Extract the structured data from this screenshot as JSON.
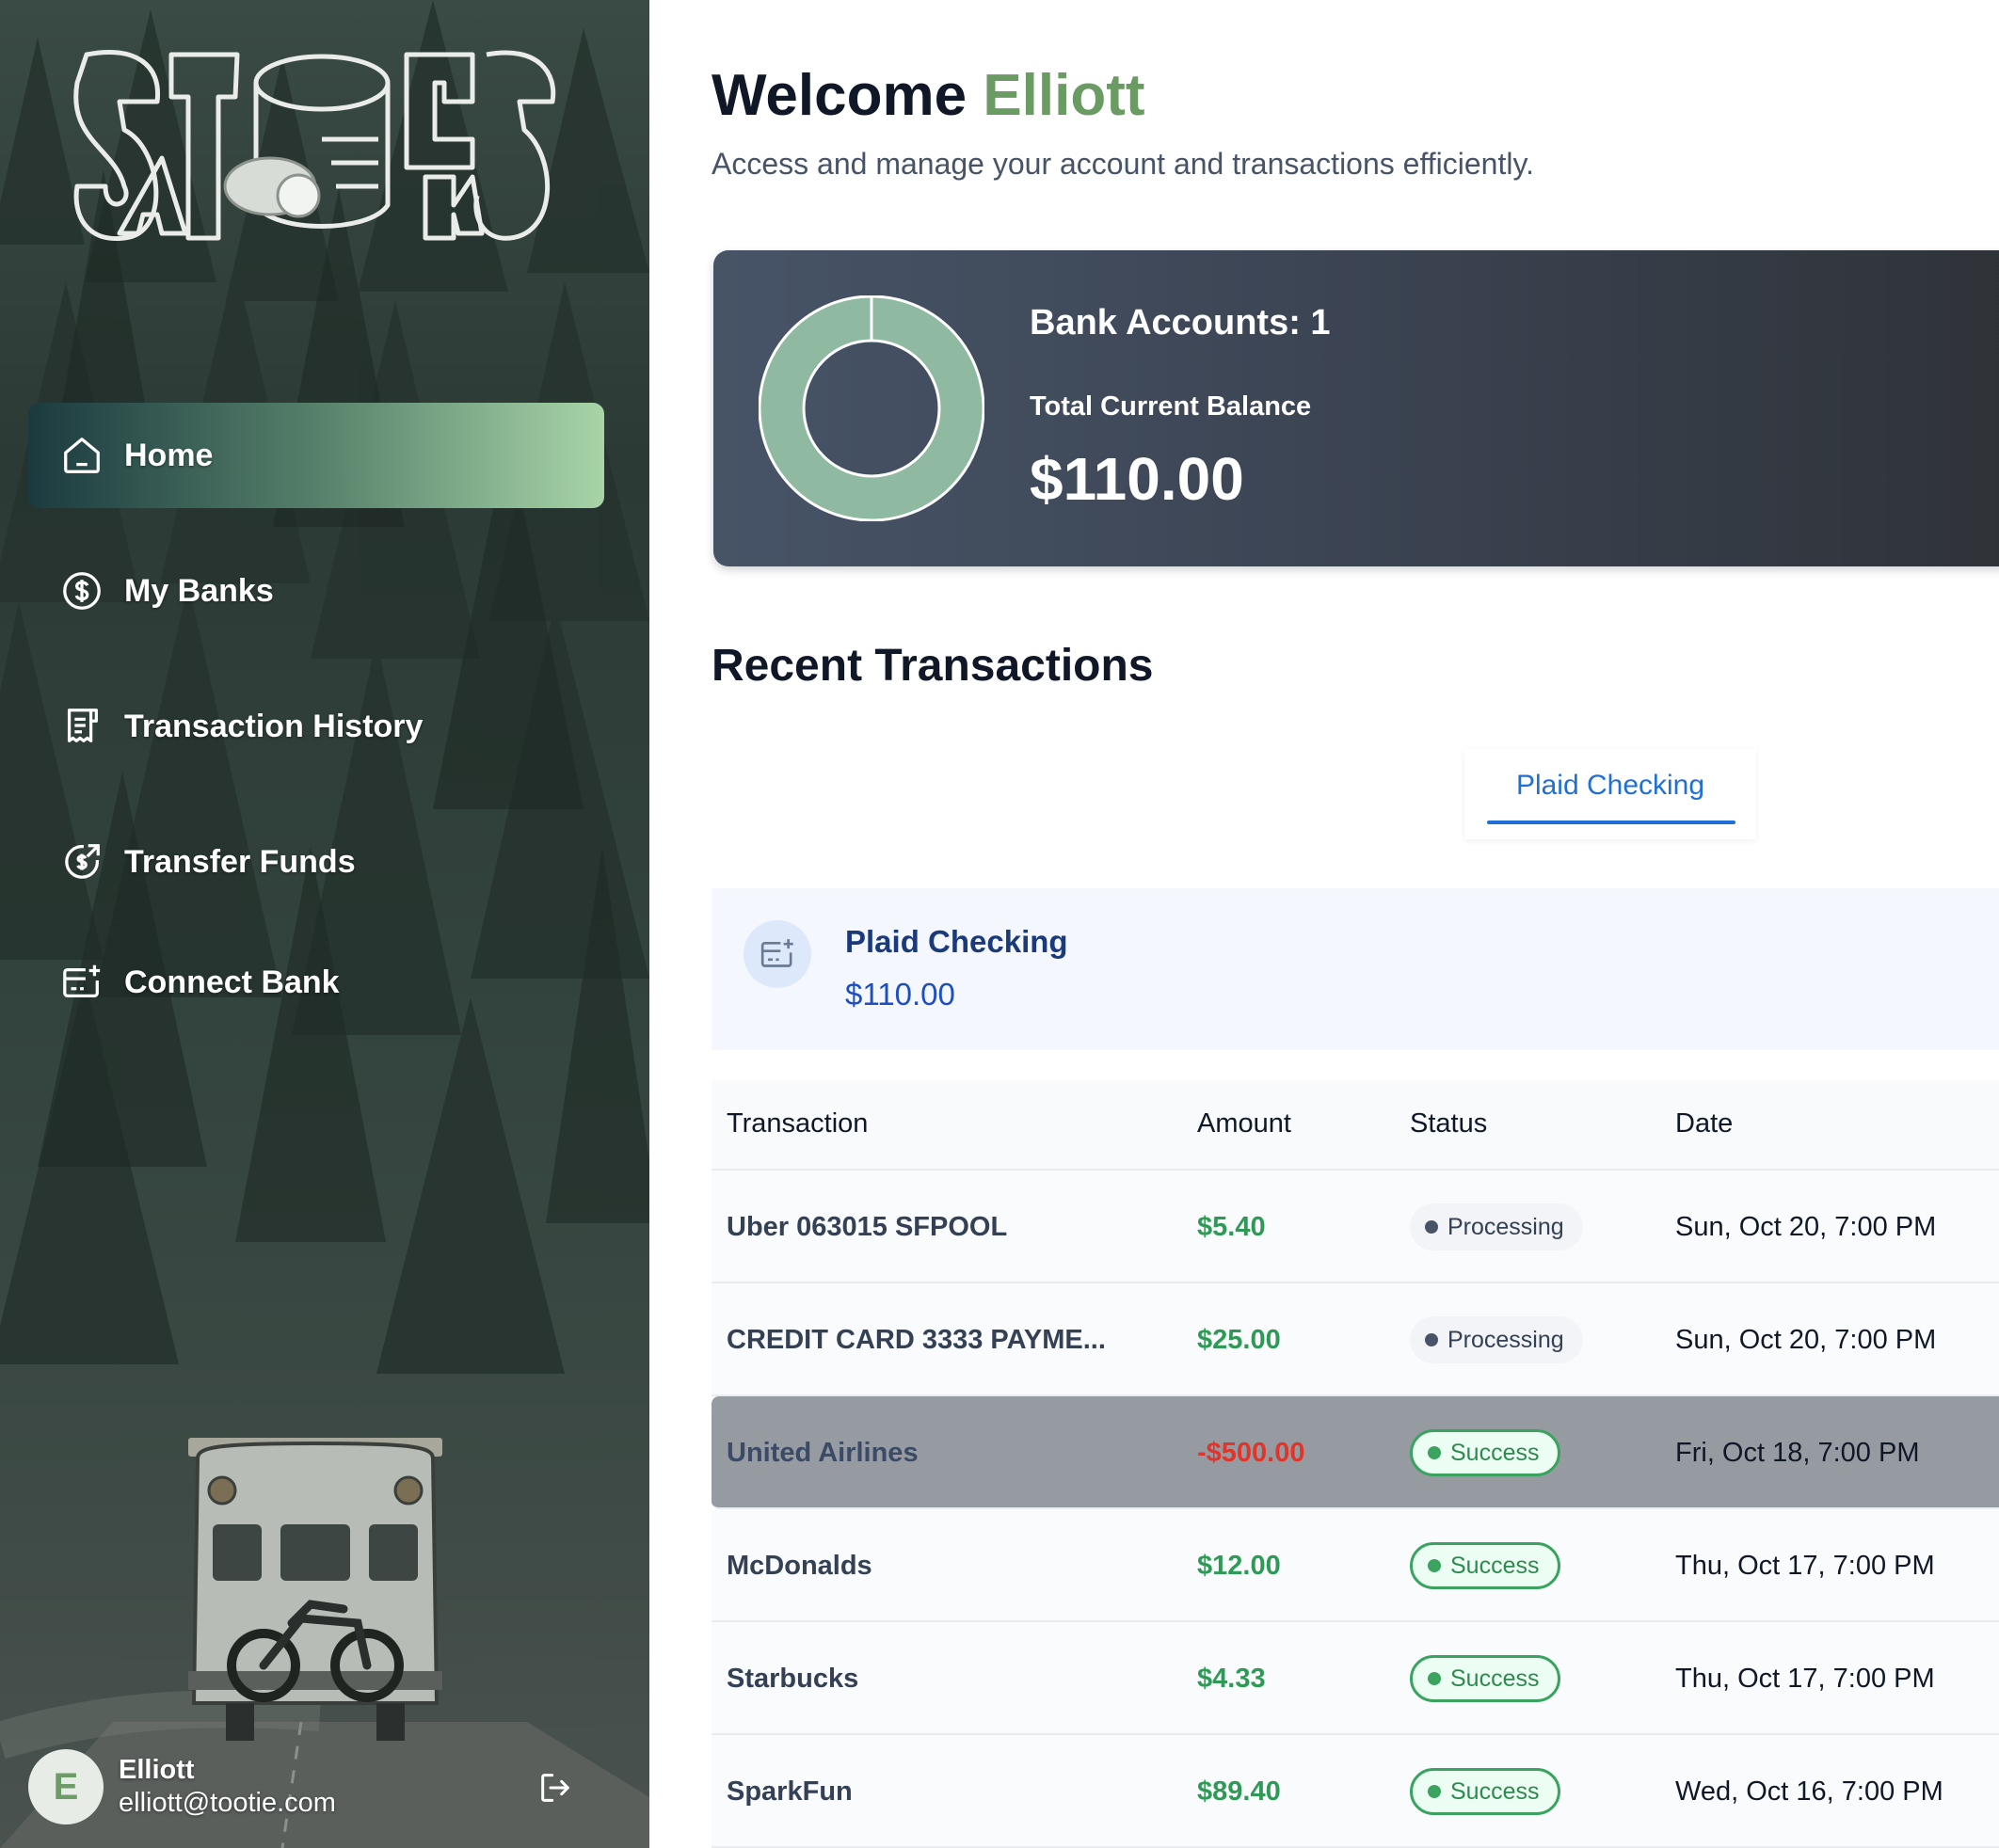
{
  "app": {
    "brand_name": "STACKS SACKS"
  },
  "sidebar": {
    "items": [
      {
        "label": "Home",
        "icon": "home-icon",
        "active": true
      },
      {
        "label": "My Banks",
        "icon": "dollar-circle-icon",
        "active": false
      },
      {
        "label": "Transaction History",
        "icon": "receipt-icon",
        "active": false
      },
      {
        "label": "Transfer Funds",
        "icon": "money-send-icon",
        "active": false
      },
      {
        "label": "Connect Bank",
        "icon": "card-add-icon",
        "active": false
      }
    ],
    "user": {
      "initial": "E",
      "name": "Elliott",
      "email": "elliott@tootie.com",
      "logout_icon": "logout-icon"
    }
  },
  "header": {
    "welcome_prefix": "Welcome",
    "user_name": "Elliott",
    "subtitle": "Access and manage your account and transactions efficiently."
  },
  "balance": {
    "accounts_label": "Bank Accounts: 1",
    "total_label": "Total Current Balance",
    "total_value": "$110.00",
    "donut_color": "#8fb9a0"
  },
  "recent": {
    "title": "Recent Transactions",
    "tabs": [
      {
        "label": "Plaid Checking",
        "active": true
      }
    ],
    "account": {
      "name": "Plaid Checking",
      "balance": "$110.00"
    },
    "columns": [
      "Transaction",
      "Amount",
      "Status",
      "Date"
    ],
    "rows": [
      {
        "name": "Uber 063015 SFPOOL",
        "amount": "$5.40",
        "negative": false,
        "status": "Processing",
        "date": "Sun, Oct 20, 7:00 PM"
      },
      {
        "name": "CREDIT CARD 3333 PAYME...",
        "amount": "$25.00",
        "negative": false,
        "status": "Processing",
        "date": "Sun, Oct 20, 7:00 PM"
      },
      {
        "name": "United Airlines",
        "amount": "-$500.00",
        "negative": true,
        "status": "Success",
        "date": "Fri, Oct 18, 7:00 PM"
      },
      {
        "name": "McDonalds",
        "amount": "$12.00",
        "negative": false,
        "status": "Success",
        "date": "Thu, Oct 17, 7:00 PM"
      },
      {
        "name": "Starbucks",
        "amount": "$4.33",
        "negative": false,
        "status": "Success",
        "date": "Thu, Oct 17, 7:00 PM"
      },
      {
        "name": "SparkFun",
        "amount": "$89.40",
        "negative": false,
        "status": "Success",
        "date": "Wed, Oct 16, 7:00 PM"
      }
    ]
  },
  "colors": {
    "accent_green": "#6a9b63",
    "link_blue": "#1f6fd6",
    "positive": "#2f9a55",
    "negative": "#e0352b"
  }
}
